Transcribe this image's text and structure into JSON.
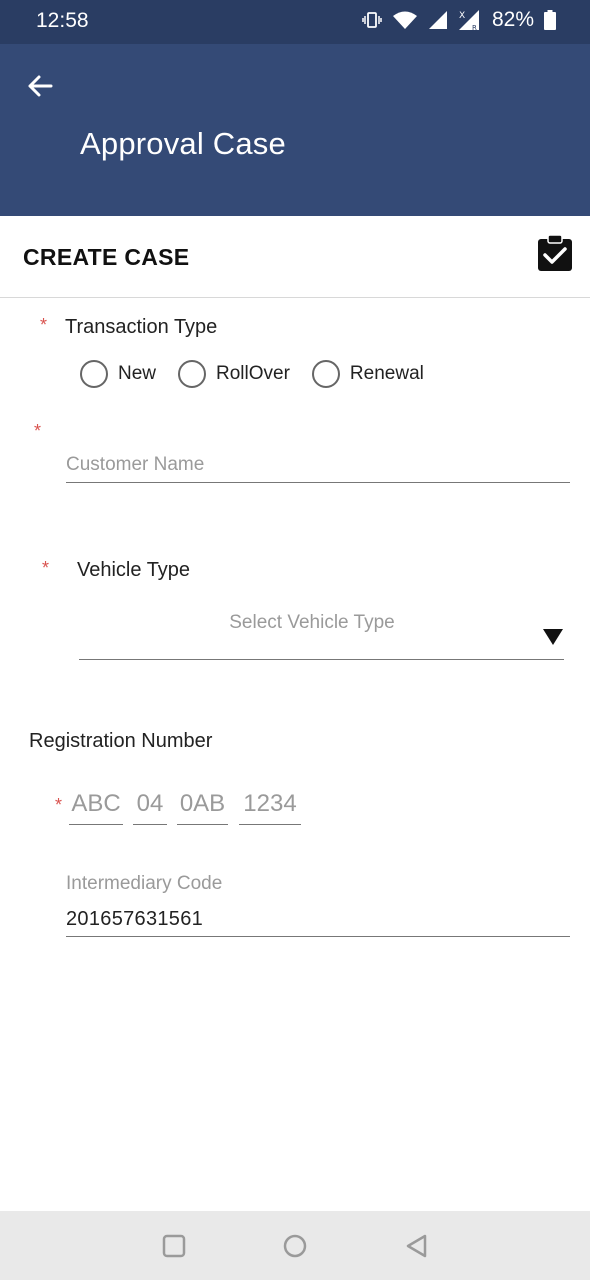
{
  "status_bar": {
    "time": "12:58",
    "battery": "82%",
    "icons": [
      "vibrate-icon",
      "wifi-icon",
      "signal-icon",
      "signal-roaming-icon",
      "battery-icon"
    ]
  },
  "app_bar": {
    "title": "Approval Case",
    "back_icon": "arrow-left-icon",
    "background": "#344a76"
  },
  "card": {
    "header_title": "CREATE CASE",
    "action_icon": "clipboard-check-icon"
  },
  "form": {
    "required_marker": "*",
    "transaction_type": {
      "label": "Transaction Type",
      "options": [
        "New",
        "RollOver",
        "Renewal"
      ],
      "selected": null
    },
    "customer_name": {
      "placeholder": "Customer Name",
      "value": ""
    },
    "vehicle_type": {
      "label": "Vehicle Type",
      "placeholder": "Select Vehicle Type"
    },
    "registration": {
      "label": "Registration Number",
      "parts": [
        "ABC",
        "04",
        "0AB",
        "1234"
      ]
    },
    "intermediary_code": {
      "label": "Intermediary Code",
      "value": "201657631561"
    }
  },
  "nav_bar": {
    "buttons": [
      "recents-square-icon",
      "home-circle-icon",
      "back-triangle-icon"
    ]
  }
}
